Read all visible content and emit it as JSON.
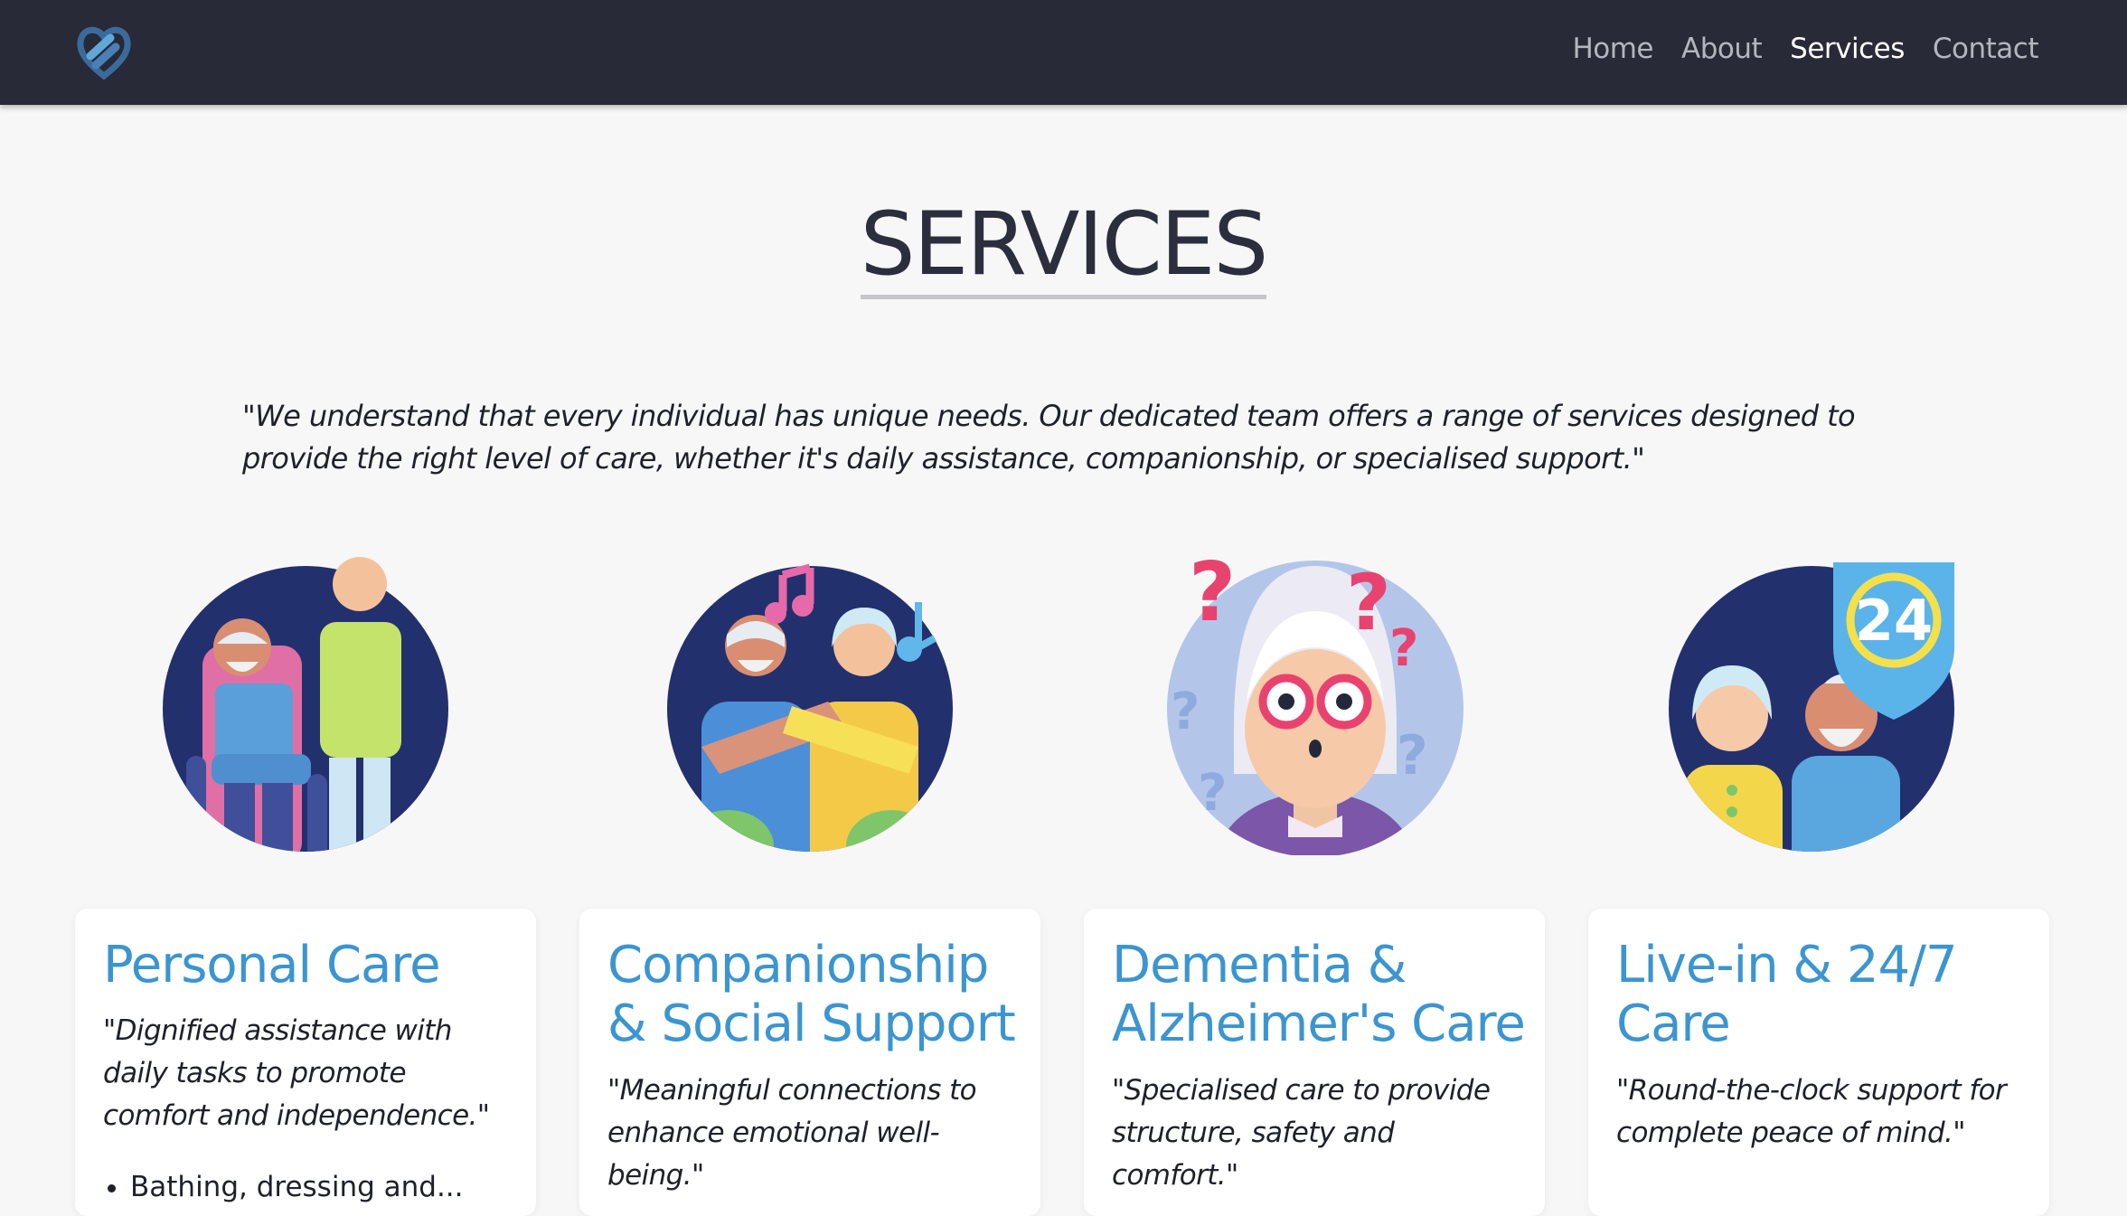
{
  "nav": {
    "links": [
      {
        "label": "Home"
      },
      {
        "label": "About"
      },
      {
        "label": "Services"
      },
      {
        "label": "Contact"
      }
    ],
    "active": "Services"
  },
  "page": {
    "title": "SERVICES",
    "intro": "\"We understand that every individual has unique needs. Our dedicated team offers a range of services designed to provide the right level of care, whether it's daily assistance, companionship, or specialised support.\""
  },
  "services": [
    {
      "title": "Personal Care",
      "description": "\"Dignified assistance with daily tasks to promote comfort and independence.\"",
      "list_first_item": "Bathing, dressing and...",
      "illustration": "caregiver-wheelchair-illustration"
    },
    {
      "title": "Companionship & Social Support",
      "description": "\"Meaningful connections to enhance emotional well-being.\"",
      "illustration": "elderly-couple-music-illustration"
    },
    {
      "title": "Dementia & Alzheimer's Care",
      "description": "\"Specialised care to provide structure, safety and comfort.\"",
      "illustration": "confused-elderly-woman-illustration"
    },
    {
      "title": "Live-in & 24/7 Care",
      "description": "\"Round-the-clock support for complete peace of mind.\"",
      "illustration": "elderly-couple-24-shield-illustration"
    }
  ],
  "shield_label": "24",
  "colors": {
    "navbar": "#282a37",
    "accent": "#3b95d0",
    "background": "#f7f7f8",
    "illustration_navy": "#23306e"
  }
}
